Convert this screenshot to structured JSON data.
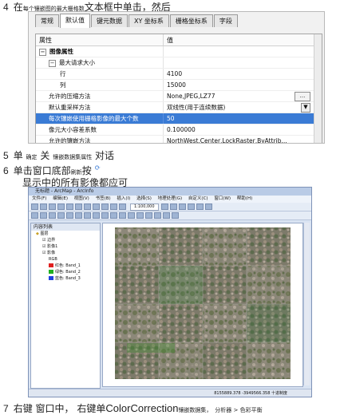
{
  "step4": {
    "num": "4",
    "prefix": "在",
    "small": "每个镶嵌图的最大栅格数",
    "text": "文本框中单击，然后"
  },
  "dialog": {
    "tabs": [
      "常规",
      "默认值",
      "键元数据",
      "XY 坐标系",
      "栅格坐标系",
      "字段"
    ],
    "header_col1": "属性",
    "header_col2": "值",
    "rows": [
      {
        "label": "图像属性",
        "value": ""
      },
      {
        "label": "最大请求大小",
        "value": ""
      },
      {
        "label": "行",
        "value": "4100"
      },
      {
        "label": "列",
        "value": "15000"
      },
      {
        "label": "允许的压缩方法",
        "value": "None,JPEG,LZ77"
      },
      {
        "label": "默认重采样方法",
        "value": "双线性(用于连续数据)"
      },
      {
        "label": "每次镶嵌使用栅格影像的最大个数",
        "value": "50"
      },
      {
        "label": "像元大小容差系数",
        "value": "0.100000"
      },
      {
        "label": "允许的镶嵌方法",
        "value": "NorthWest,Center,LockRaster,ByAttrib..."
      }
    ],
    "ellipsis": "...",
    "dropdown_arrow": "▼"
  },
  "step5": {
    "num": "5",
    "prefix": "单",
    "small1": "确定",
    "mid": "关",
    "small2": "镶嵌数据集属性",
    "text": "对话"
  },
  "step6": {
    "num": "6",
    "text": "单击窗口底部",
    "small": "刷新",
    "suffix": "按"
  },
  "step6b": {
    "text": "显示中的所有影像都应可"
  },
  "arcmap": {
    "title": "无标题 - ArcMap - ArcInfo",
    "menu": [
      "文件(F)",
      "编辑(E)",
      "视图(V)",
      "书签(B)",
      "插入(I)",
      "选择(S)",
      "地理处理(G)",
      "自定义(C)",
      "窗口(W)",
      "帮助(H)"
    ],
    "scale": "1:100,000",
    "toc_title": "内容列表",
    "toc_items": [
      "图层",
      "边界",
      "影像1",
      "影像",
      "RGB",
      "红色: Band_1",
      "绿色: Band_2",
      "蓝色: Band_3"
    ],
    "status": "8155889.378  -3949566.358  十进制度"
  },
  "step7": {
    "num": "7",
    "prefix": "右键",
    "mid": "窗口中，",
    "mid2": "右键单",
    "big": "ColorCorrection",
    "mid3": "镶嵌数据集，",
    "small": "分析器 > 色彩平衡"
  },
  "colors": {
    "selection": "#3a7bd5",
    "dialog_bg": "#f1f1f1",
    "arcmap_frame": "#d9e3f2"
  }
}
